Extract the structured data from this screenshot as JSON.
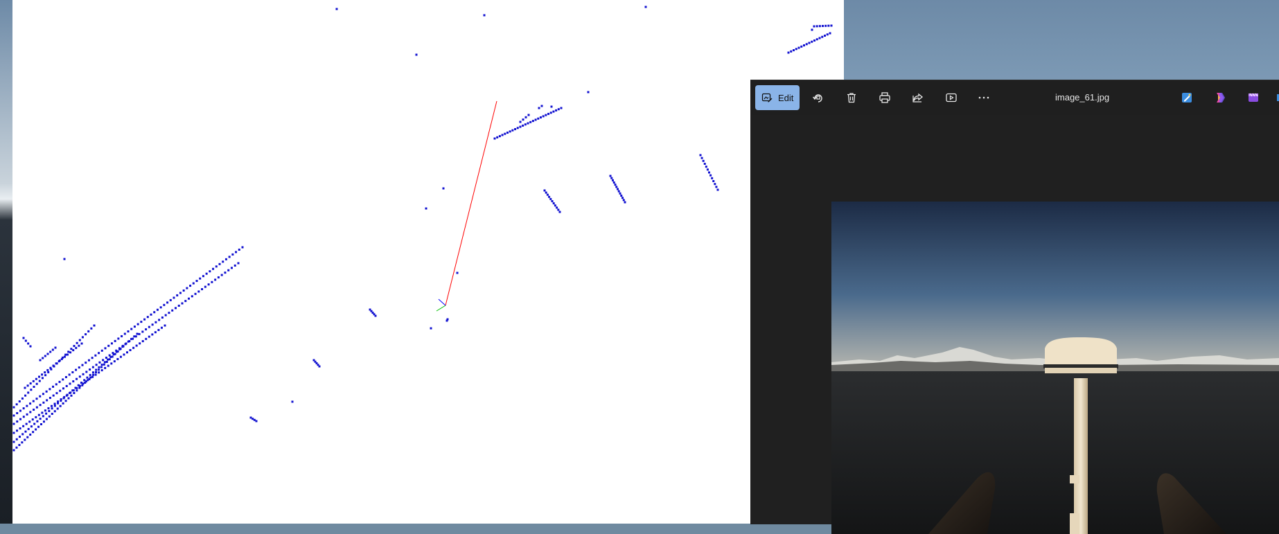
{
  "photos_window": {
    "title": "image_61.jpg",
    "toolbar": {
      "edit_label": "Edit",
      "buttons": [
        {
          "name": "rotate-button",
          "icon": "rotate-icon"
        },
        {
          "name": "delete-button",
          "icon": "trash-icon"
        },
        {
          "name": "print-button",
          "icon": "printer-icon"
        },
        {
          "name": "share-button",
          "icon": "share-icon"
        },
        {
          "name": "slideshow-button",
          "icon": "play-icon"
        },
        {
          "name": "more-button",
          "icon": "more-icon"
        }
      ],
      "app_icons": [
        "paint-icon",
        "copilot-icon",
        "clipchamp-icon"
      ]
    }
  },
  "colors": {
    "point": "#1010d0",
    "axis_x": "#ff0000",
    "axis_y": "#00c000",
    "axis_z": "#0000ff",
    "edit_accent": "#8ab4e8",
    "window_bg": "#1f1f1f"
  }
}
